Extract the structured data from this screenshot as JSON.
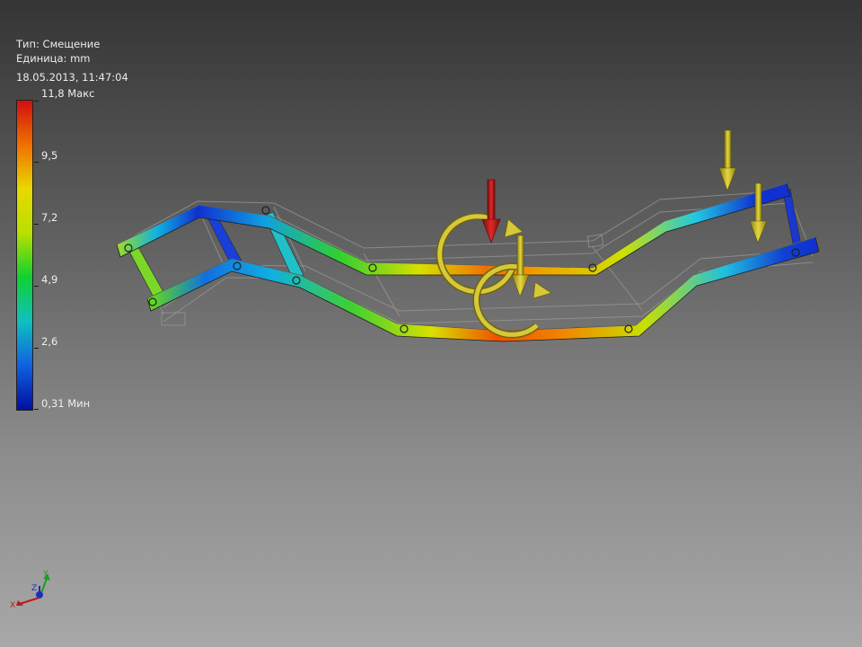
{
  "result_info": {
    "type_line": "Тип: Смещение",
    "unit_line": "Единица: mm",
    "timestamp": "18.05.2013, 11:47:04"
  },
  "legend": {
    "max_label": "11,8 Макс",
    "min_label": "0,31 Мин",
    "ticks": [
      "11,8 Макс",
      "9,5",
      "7,2",
      "4,9",
      "2,6",
      "0,31 Мин"
    ],
    "colors": [
      "#d01010",
      "#f07000",
      "#e8d800",
      "#b8e000",
      "#10d030",
      "#10c0c0",
      "#1060e0",
      "#0010a0"
    ]
  },
  "triad": {
    "x": "X",
    "y": "Y",
    "z": "Z"
  },
  "colors": {
    "load_arrow": "#c8b820",
    "main_load_arrow": "#c01818",
    "background_top": "#353535",
    "background_bottom": "#a8a8a8"
  }
}
